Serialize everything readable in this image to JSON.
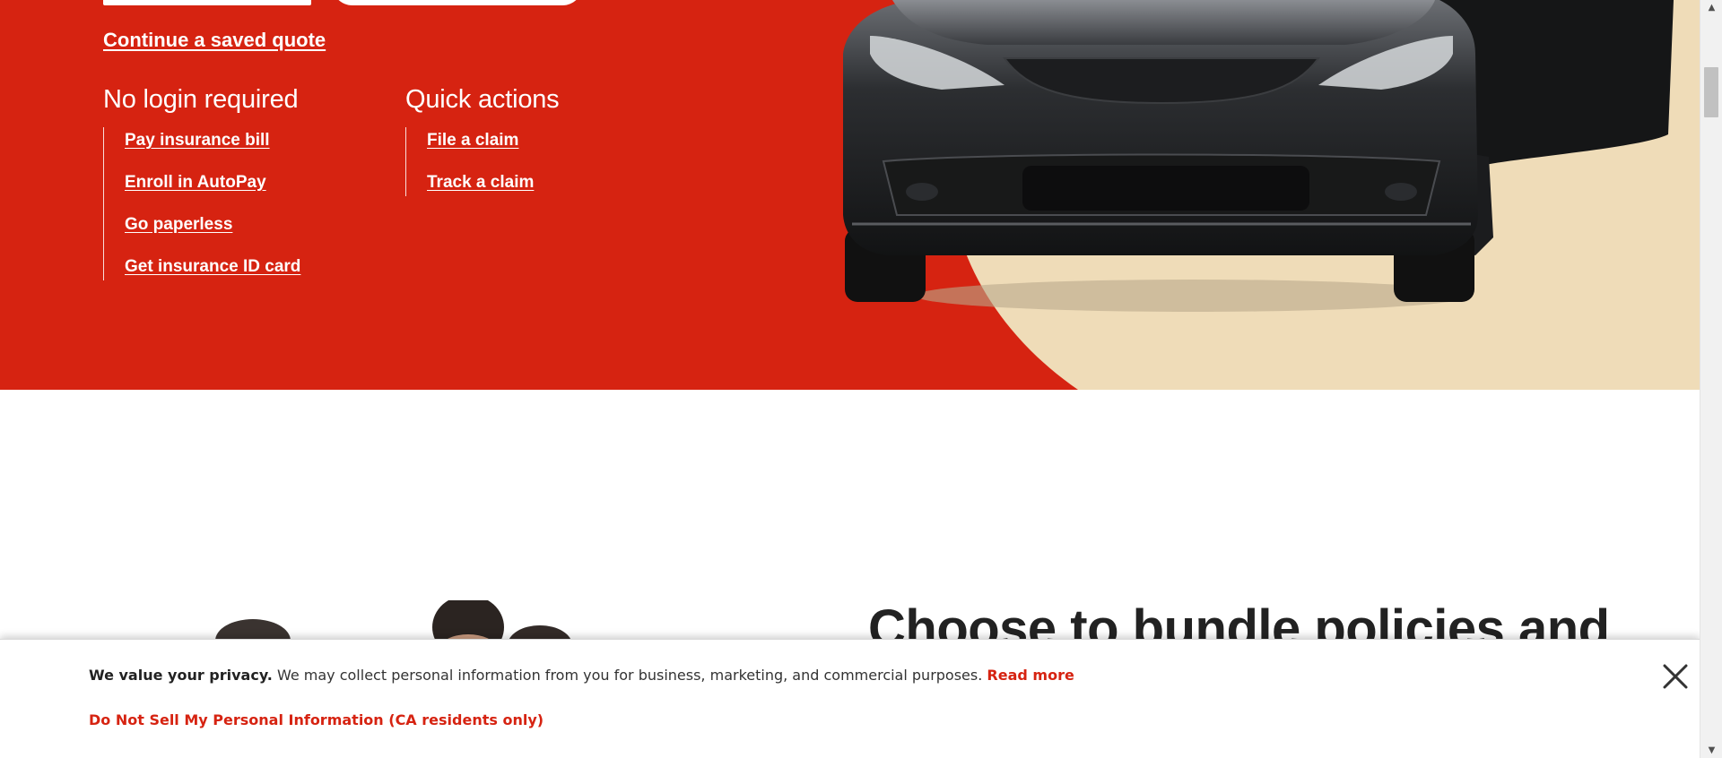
{
  "hero": {
    "continue_quote": "Continue a saved quote",
    "no_login": {
      "heading": "No login required",
      "links": [
        "Pay insurance bill",
        "Enroll in AutoPay",
        "Go paperless",
        "Get insurance ID card"
      ]
    },
    "quick_actions": {
      "heading": "Quick actions",
      "links": [
        "File a claim",
        "Track a claim"
      ]
    }
  },
  "bundle": {
    "heading": "Choose to bundle policies and"
  },
  "privacy_banner": {
    "bold_text": "We value your privacy.",
    "text": " We may collect personal information from you for business, marketing, and commercial purposes. ",
    "read_more": "Read more",
    "do_not_sell": "Do Not Sell My Personal Information (CA residents only)"
  },
  "icons": {
    "close": "close-icon",
    "scroll_up": "scroll-up-arrow-icon",
    "scroll_down": "scroll-down-arrow-icon"
  },
  "colors": {
    "brand_red": "#d62311",
    "hero_beige": "#efdcb8",
    "text_dark": "#222222"
  }
}
